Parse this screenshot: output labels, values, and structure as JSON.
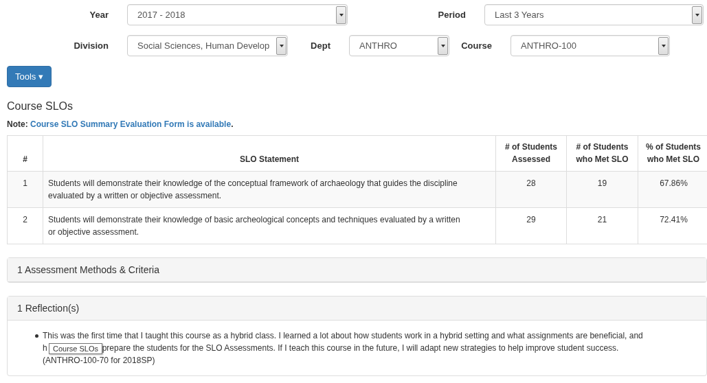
{
  "filters": [
    {
      "label": "Year",
      "value": "2017 - 2018"
    },
    {
      "label": "Period",
      "value": "Last 3 Years"
    },
    {
      "label": "Division",
      "value": "Social Sciences, Human Develop"
    },
    {
      "label": "Dept",
      "value": "ANTHRO"
    },
    {
      "label": "Course",
      "value": "ANTHRO-100"
    }
  ],
  "tools_button": {
    "label": "Tools",
    "caret": "▾"
  },
  "section_title": "Course SLOs",
  "note": {
    "label": "Note:",
    "link": "Course SLO Summary Evaluation Form is available",
    "end": "."
  },
  "table": {
    "columns": [
      "#",
      "SLO Statement",
      "# of Students Assessed",
      "# of Students who Met SLO",
      "% of Students who Met SLO"
    ],
    "rows": [
      [
        "1",
        "Students will demonstrate their knowledge of the conceptual framework of archaeology that guides the discipline evaluated by a written or objective assessment.",
        "28",
        "19",
        "67.86%"
      ],
      [
        "2",
        "Students will demonstrate their knowledge of basic archeological concepts and techniques evaluated by a written or objective assessment.",
        "29",
        "21",
        "72.41%"
      ]
    ]
  },
  "panels": [
    {
      "title": "1 Assessment Methods & Criteria",
      "expanded": false
    },
    {
      "title": "1 Reflection(s)",
      "expanded": true,
      "items": [
        {
          "line_1": "This was the first time that I taught this course as a hybrid class. I learned a lot about how students work in a hybrid setting and what assignments are beneficial, and",
          "line_2_start": "h",
          "line_2_end": "prepare the students for the SLO Assessments. If I teach this course in the future, I will adapt new strategies to help improve student success.",
          "line_3": "(ANTHRO-100-70 for 2018SP)"
        }
      ]
    }
  ],
  "tooltip": "Course SLOs"
}
